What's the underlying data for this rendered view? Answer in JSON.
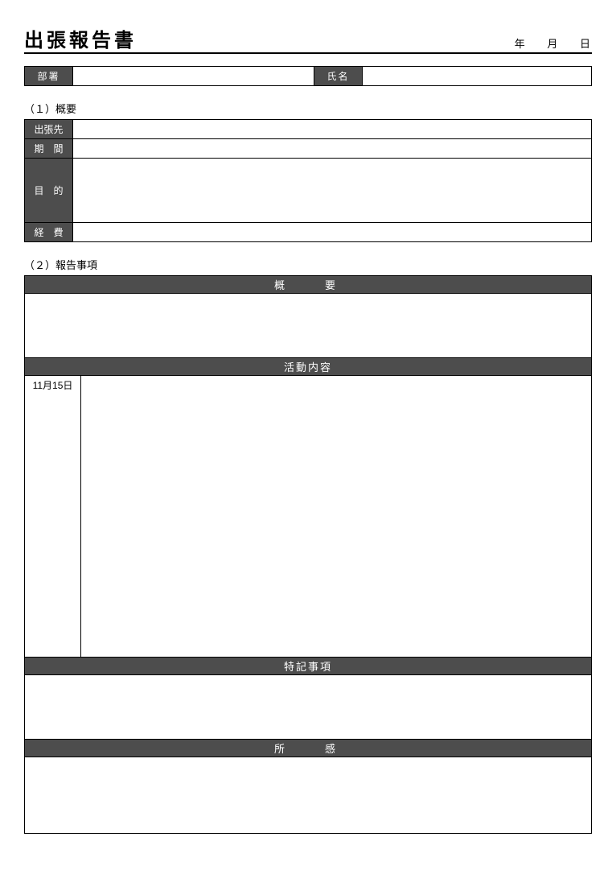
{
  "title": "出張報告書",
  "date": {
    "year": "年",
    "month": "月",
    "day": "日"
  },
  "info": {
    "dept_label": "部署",
    "dept_value": "",
    "name_label": "氏名",
    "name_value": ""
  },
  "section1": {
    "heading": "（１）概要",
    "rows": {
      "destination": {
        "label": "出張先",
        "value": ""
      },
      "period": {
        "label": "期　間",
        "value": ""
      },
      "purpose": {
        "label": "目　的",
        "value": ""
      },
      "expense": {
        "label": "経　費",
        "value": ""
      }
    }
  },
  "section2": {
    "heading": "（２）報告事項",
    "summary": {
      "header": "概　　要",
      "value": ""
    },
    "activity": {
      "header": "活動内容",
      "date": "11月15日",
      "value": ""
    },
    "notes": {
      "header": "特記事項",
      "value": ""
    },
    "impression": {
      "header": "所　　感",
      "value": ""
    }
  }
}
